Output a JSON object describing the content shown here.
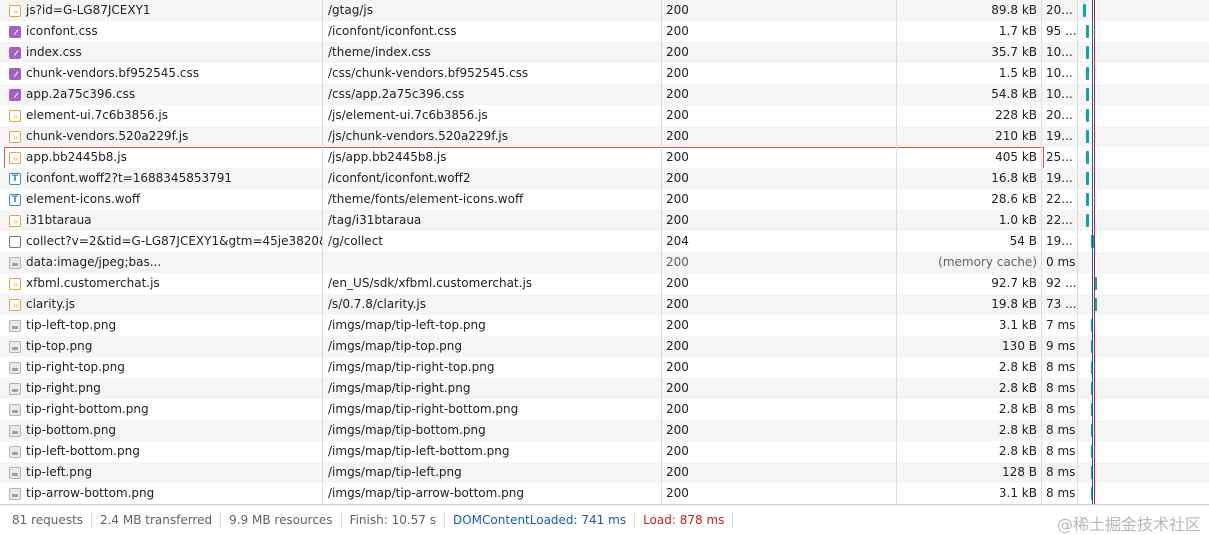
{
  "colors": {
    "dom_content_loaded": "#1a57b8",
    "load": "#c5221f",
    "selected_border": "#d9534f",
    "waterfall_bar": "#12a3a3"
  },
  "rows": [
    {
      "name": "js?id=G-LG87JCEXY1",
      "path": "/gtag/js",
      "status": "200",
      "size": "89.8 kB",
      "time": "20...",
      "icon": "script-icon",
      "wf_start": 0.04,
      "wf_len": 0.02
    },
    {
      "name": "iconfont.css",
      "path": "/iconfont/iconfont.css",
      "status": "200",
      "size": "1.7 kB",
      "time": "95 ...",
      "icon": "css-icon",
      "wf_start": 0.06,
      "wf_len": 0.02
    },
    {
      "name": "index.css",
      "path": "/theme/index.css",
      "status": "200",
      "size": "35.7 kB",
      "time": "10...",
      "icon": "css-icon",
      "wf_start": 0.06,
      "wf_len": 0.02
    },
    {
      "name": "chunk-vendors.bf952545.css",
      "path": "/css/chunk-vendors.bf952545.css",
      "status": "200",
      "size": "1.5 kB",
      "time": "10...",
      "icon": "css-icon",
      "wf_start": 0.06,
      "wf_len": 0.02
    },
    {
      "name": "app.2a75c396.css",
      "path": "/css/app.2a75c396.css",
      "status": "200",
      "size": "54.8 kB",
      "time": "10...",
      "icon": "css-icon",
      "wf_start": 0.06,
      "wf_len": 0.02
    },
    {
      "name": "element-ui.7c6b3856.js",
      "path": "/js/element-ui.7c6b3856.js",
      "status": "200",
      "size": "228 kB",
      "time": "20...",
      "icon": "script-icon",
      "wf_start": 0.06,
      "wf_len": 0.02
    },
    {
      "name": "chunk-vendors.520a229f.js",
      "path": "/js/chunk-vendors.520a229f.js",
      "status": "200",
      "size": "210 kB",
      "time": "19...",
      "icon": "script-icon",
      "wf_start": 0.06,
      "wf_len": 0.02
    },
    {
      "name": "app.bb2445b8.js",
      "path": "/js/app.bb2445b8.js",
      "status": "200",
      "size": "405 kB",
      "time": "25...",
      "icon": "script-icon",
      "wf_start": 0.06,
      "wf_len": 0.02,
      "selected": true
    },
    {
      "name": "iconfont.woff2?t=1688345853791",
      "path": "/iconfont/iconfont.woff2",
      "status": "200",
      "size": "16.8 kB",
      "time": "19...",
      "icon": "font-icon",
      "wf_start": 0.06,
      "wf_len": 0.02
    },
    {
      "name": "element-icons.woff",
      "path": "/theme/fonts/element-icons.woff",
      "status": "200",
      "size": "28.6 kB",
      "time": "22...",
      "icon": "font-icon",
      "wf_start": 0.06,
      "wf_len": 0.02
    },
    {
      "name": "i31btaraua",
      "path": "/tag/i31btaraua",
      "status": "200",
      "size": "1.0 kB",
      "time": "22...",
      "icon": "script-icon",
      "wf_start": 0.06,
      "wf_len": 0.02
    },
    {
      "name": "collect?v=2&tid=G-LG87JCEXY1&gtm=45je3820&_p...",
      "path": "/g/collect",
      "status": "204",
      "size": "54 B",
      "time": "19...",
      "icon": "document-icon",
      "wf_start": 0.1,
      "wf_len": 0.025
    },
    {
      "name": "data:image/jpeg;bas...",
      "path": "",
      "status": "200",
      "size": "(memory cache)",
      "time": "0 ms",
      "icon": "image-icon",
      "dim": true,
      "wf_start": 0.11,
      "wf_len": 0.005
    },
    {
      "name": "xfbml.customerchat.js",
      "path": "/en_US/sdk/xfbml.customerchat.js",
      "status": "200",
      "size": "92.7 kB",
      "time": "92 ...",
      "icon": "script-icon",
      "wf_start": 0.12,
      "wf_len": 0.02
    },
    {
      "name": "clarity.js",
      "path": "/s/0.7.8/clarity.js",
      "status": "200",
      "size": "19.8 kB",
      "time": "73 ...",
      "icon": "script-icon",
      "wf_start": 0.12,
      "wf_len": 0.02
    },
    {
      "name": "tip-left-top.png",
      "path": "/imgs/map/tip-left-top.png",
      "status": "200",
      "size": "3.1 kB",
      "time": "7 ms",
      "icon": "image-icon",
      "wf_start": 0.1,
      "wf_len": 0.01
    },
    {
      "name": "tip-top.png",
      "path": "/imgs/map/tip-top.png",
      "status": "200",
      "size": "130 B",
      "time": "9 ms",
      "icon": "image-icon",
      "wf_start": 0.1,
      "wf_len": 0.01
    },
    {
      "name": "tip-right-top.png",
      "path": "/imgs/map/tip-right-top.png",
      "status": "200",
      "size": "2.8 kB",
      "time": "8 ms",
      "icon": "image-icon",
      "wf_start": 0.1,
      "wf_len": 0.01
    },
    {
      "name": "tip-right.png",
      "path": "/imgs/map/tip-right.png",
      "status": "200",
      "size": "2.8 kB",
      "time": "8 ms",
      "icon": "image-icon",
      "wf_start": 0.1,
      "wf_len": 0.01
    },
    {
      "name": "tip-right-bottom.png",
      "path": "/imgs/map/tip-right-bottom.png",
      "status": "200",
      "size": "2.8 kB",
      "time": "8 ms",
      "icon": "image-icon",
      "wf_start": 0.1,
      "wf_len": 0.01
    },
    {
      "name": "tip-bottom.png",
      "path": "/imgs/map/tip-bottom.png",
      "status": "200",
      "size": "2.8 kB",
      "time": "8 ms",
      "icon": "image-icon",
      "wf_start": 0.1,
      "wf_len": 0.01
    },
    {
      "name": "tip-left-bottom.png",
      "path": "/imgs/map/tip-left-bottom.png",
      "status": "200",
      "size": "2.8 kB",
      "time": "8 ms",
      "icon": "image-icon",
      "wf_start": 0.1,
      "wf_len": 0.01
    },
    {
      "name": "tip-left.png",
      "path": "/imgs/map/tip-left.png",
      "status": "200",
      "size": "128 B",
      "time": "8 ms",
      "icon": "image-icon",
      "wf_start": 0.1,
      "wf_len": 0.01
    },
    {
      "name": "tip-arrow-bottom.png",
      "path": "/imgs/map/tip-arrow-bottom.png",
      "status": "200",
      "size": "3.1 kB",
      "time": "8 ms",
      "icon": "image-icon",
      "wf_start": 0.1,
      "wf_len": 0.01
    }
  ],
  "statusbar": {
    "requests": "81 requests",
    "transferred": "2.4 MB transferred",
    "resources": "9.9 MB resources",
    "finish": "Finish: 10.57 s",
    "dom_content_loaded": "DOMContentLoaded: 741 ms",
    "load": "Load: 878 ms"
  },
  "watermark": "@稀土掘金技术社区"
}
